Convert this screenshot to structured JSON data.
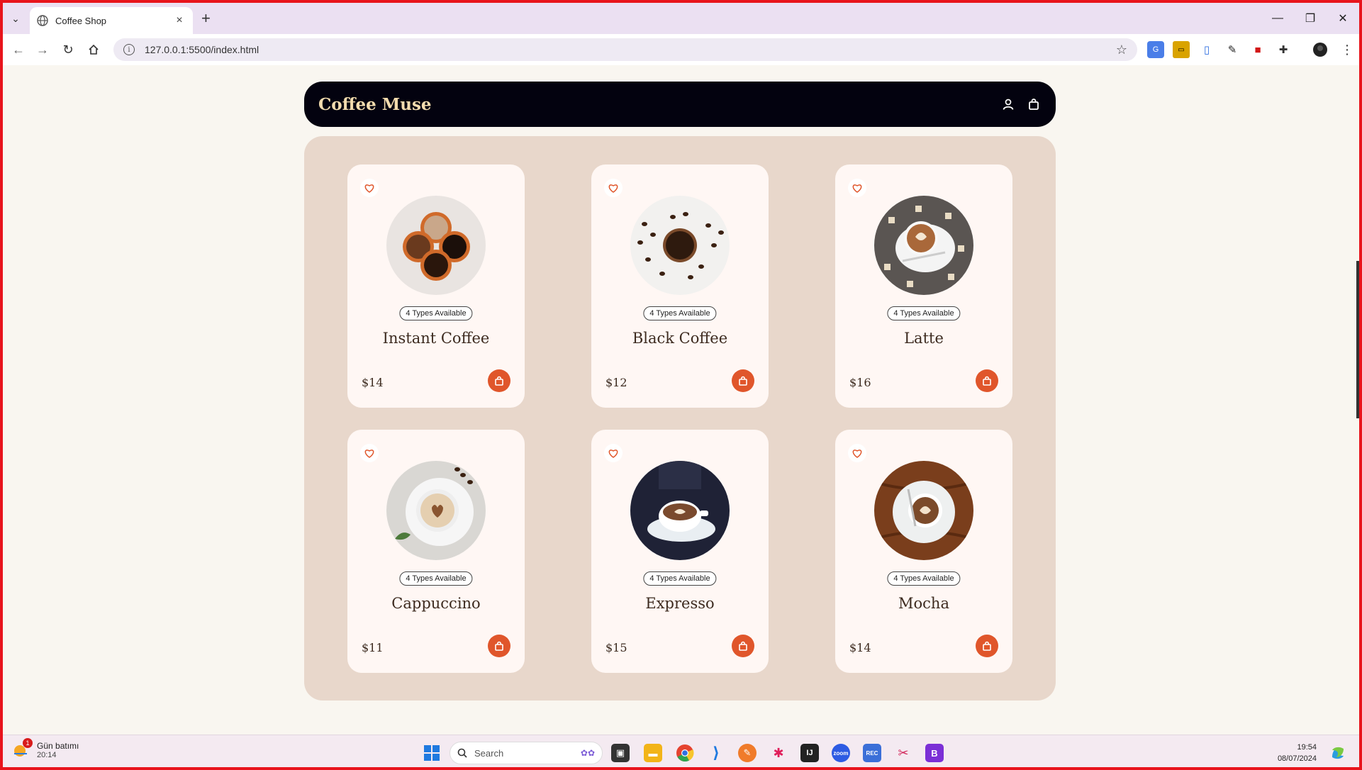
{
  "browser": {
    "tab_title": "Coffee Shop",
    "new_tab_symbol": "+",
    "url": "127.0.0.1:5500/index.html"
  },
  "site": {
    "brand": "Coffee Muse",
    "brand_color": "#f3dcae",
    "accent_color": "#e0562b"
  },
  "products": [
    {
      "badge": "4 Types Available",
      "name": "Instant Coffee",
      "price": "$14",
      "photo": "instant-coffee-photo"
    },
    {
      "badge": "4 Types Available",
      "name": "Black Coffee",
      "price": "$12",
      "photo": "black-coffee-photo"
    },
    {
      "badge": "4 Types Available",
      "name": "Latte",
      "price": "$16",
      "photo": "latte-photo"
    },
    {
      "badge": "4 Types Available",
      "name": "Cappuccino",
      "price": "$11",
      "photo": "cappuccino-photo"
    },
    {
      "badge": "4 Types Available",
      "name": "Expresso",
      "price": "$15",
      "photo": "expresso-photo"
    },
    {
      "badge": "4 Types Available",
      "name": "Mocha",
      "price": "$14",
      "photo": "mocha-photo"
    }
  ],
  "taskbar": {
    "weather_title": "Gün batımı",
    "weather_time": "20:14",
    "weather_badge": "1",
    "search_placeholder": "Search",
    "clock_time": "19:54",
    "clock_date": "08/07/2024"
  }
}
